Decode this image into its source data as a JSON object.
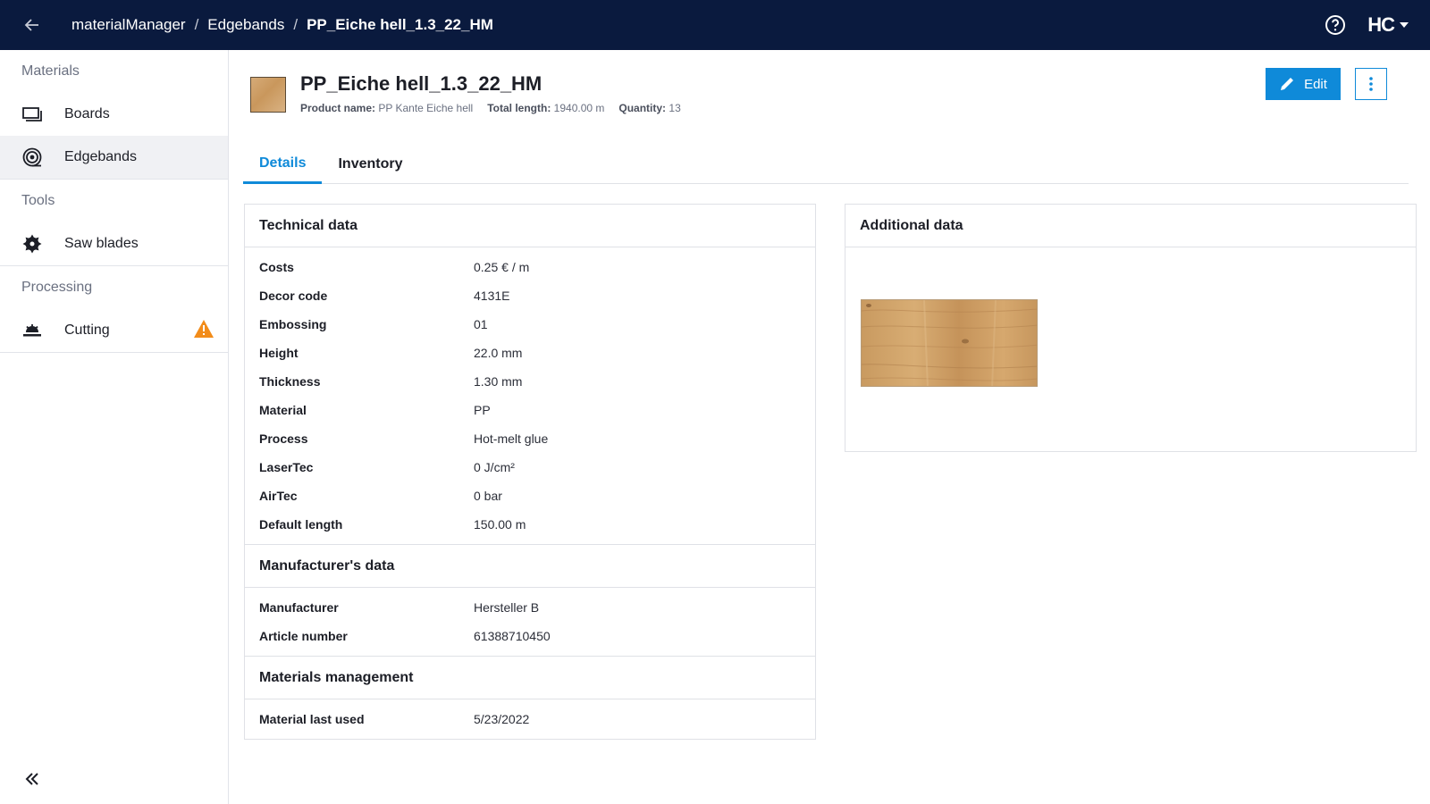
{
  "topbar": {
    "breadcrumb": [
      "materialManager",
      "Edgebands",
      "PP_Eiche hell_1.3_22_HM"
    ],
    "brand": "HC"
  },
  "sidebar": {
    "sections": [
      {
        "title": "Materials",
        "items": [
          {
            "label": "Boards",
            "icon": "board-icon"
          },
          {
            "label": "Edgebands",
            "icon": "edgeband-roll-icon"
          }
        ]
      },
      {
        "title": "Tools",
        "items": [
          {
            "label": "Saw blades",
            "icon": "saw-blade-icon"
          }
        ]
      },
      {
        "title": "Processing",
        "items": [
          {
            "label": "Cutting",
            "icon": "cutting-saw-icon"
          }
        ]
      }
    ]
  },
  "header": {
    "title": "PP_Eiche hell_1.3_22_HM",
    "product_name_label": "Product name:",
    "product_name": "PP Kante Eiche hell",
    "total_length_label": "Total length:",
    "total_length": "1940.00 m",
    "quantity_label": "Quantity:",
    "quantity": "13",
    "edit_label": "Edit"
  },
  "tabs": [
    "Details",
    "Inventory"
  ],
  "technical": {
    "title": "Technical data",
    "rows": [
      {
        "k": "Costs",
        "v": "0.25 € / m"
      },
      {
        "k": "Decor code",
        "v": "4131E"
      },
      {
        "k": "Embossing",
        "v": "01"
      },
      {
        "k": "Height",
        "v": "22.0 mm"
      },
      {
        "k": "Thickness",
        "v": "1.30 mm"
      },
      {
        "k": "Material",
        "v": "PP"
      },
      {
        "k": "Process",
        "v": "Hot-melt glue"
      },
      {
        "k": "LaserTec",
        "v": "0 J/cm²"
      },
      {
        "k": "AirTec",
        "v": "0 bar"
      },
      {
        "k": "Default length",
        "v": "150.00 m"
      }
    ]
  },
  "manufacturer": {
    "title": "Manufacturer's data",
    "rows": [
      {
        "k": "Manufacturer",
        "v": "Hersteller B"
      },
      {
        "k": "Article number",
        "v": "61388710450"
      }
    ]
  },
  "management": {
    "title": "Materials management",
    "rows": [
      {
        "k": "Material last used",
        "v": "5/23/2022"
      }
    ]
  },
  "additional": {
    "title": "Additional data"
  },
  "colors": {
    "topbar": "#0a1a3e",
    "accent": "#0f8ad9",
    "warning": "#f28c1a"
  }
}
